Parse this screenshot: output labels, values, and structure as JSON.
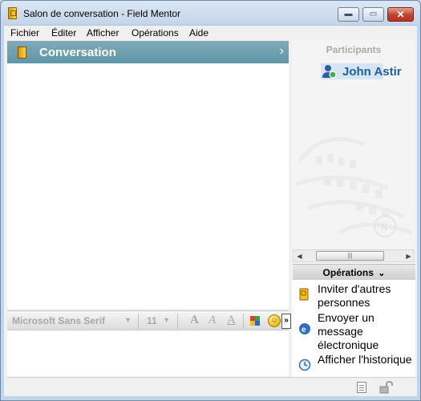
{
  "window": {
    "title": "Salon de conversation - Field Mentor",
    "min_glyph": "▬",
    "max_glyph": "▭",
    "close_glyph": "✕"
  },
  "menu": {
    "items": [
      "Fichier",
      "Éditer",
      "Afficher",
      "Opérations",
      "Aide"
    ]
  },
  "conversation": {
    "title": "Conversation",
    "chevron": "›"
  },
  "format_toolbar": {
    "font_name": "Microsoft Sans Serif",
    "font_size": "11",
    "dropdown_glyph": "▾",
    "bold_glyph": "A",
    "italic_glyph": "A",
    "underline_glyph": "A",
    "emoji_glyph": "☺",
    "more_glyph": "»"
  },
  "participants": {
    "header": "Participants",
    "list": [
      {
        "name": "John Astir",
        "status": "online"
      }
    ]
  },
  "scrollbar": {
    "left_glyph": "◀",
    "right_glyph": "▶",
    "grip_glyph": "|||"
  },
  "operations": {
    "header": "Opérations",
    "chevron": "⌄",
    "items": [
      {
        "label": "Inviter d'autres personnes",
        "icon": "invite-icon"
      },
      {
        "label": "Envoyer un message électronique",
        "icon": "email-icon"
      },
      {
        "label": "Afficher l'historique",
        "icon": "history-icon"
      }
    ]
  },
  "colors": {
    "header_teal": "#6a9fb0",
    "participant_blue": "#1f5f9d",
    "close_red": "#c1402b"
  }
}
